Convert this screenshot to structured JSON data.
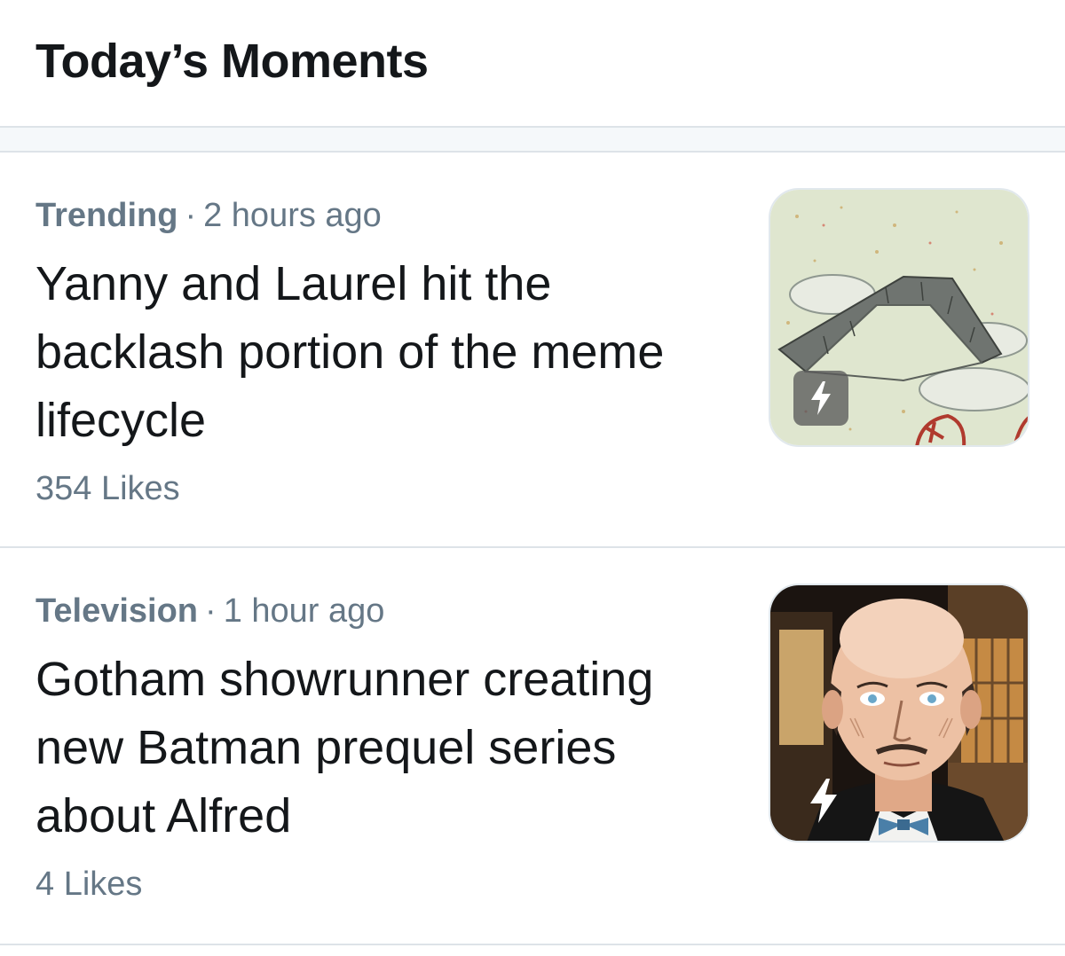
{
  "header": {
    "title": "Today’s Moments"
  },
  "moments": [
    {
      "category": "Trending",
      "separator": "·",
      "time": "2 hours ago",
      "headline": "Yanny and Laurel hit the backlash portion of the meme lifecycle",
      "likes": "354 Likes",
      "thumbnail_icon": "lightning-bolt-icon"
    },
    {
      "category": "Television",
      "separator": "·",
      "time": "1 hour ago",
      "headline": "Gotham showrunner creating new Batman prequel series about Alfred",
      "likes": "4 Likes",
      "thumbnail_icon": "lightning-bolt-icon"
    }
  ],
  "colors": {
    "text_primary": "#14171a",
    "text_secondary": "#657786",
    "divider": "#dde3e8"
  }
}
